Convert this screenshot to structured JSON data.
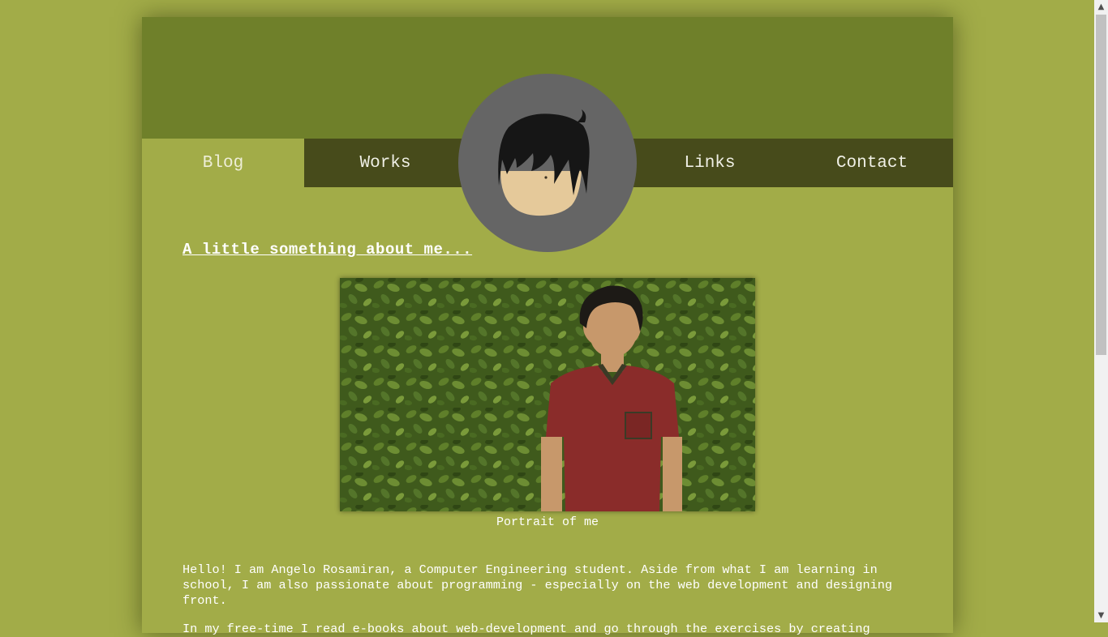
{
  "nav": {
    "items": [
      {
        "label": "Blog",
        "active": true
      },
      {
        "label": "Works",
        "active": false
      },
      {
        "label": "Links",
        "active": false
      },
      {
        "label": "Contact",
        "active": false
      }
    ]
  },
  "avatar": {
    "icon": "cartoon-face-icon"
  },
  "main": {
    "title": "A little something about me...",
    "image_caption": "Portrait of me",
    "paragraphs": [
      "Hello! I am Angelo Rosamiran, a Computer Engineering student. Aside from what I am learning in school, I am also passionate about programming - especially on the web development and designing front.",
      "In my free-time I read e-books about web-development and go through the exercises by creating"
    ]
  },
  "colors": {
    "background": "#a2ac48",
    "banner": "#6f802a",
    "navbar": "#474b1b",
    "avatar_circle": "#656565"
  }
}
